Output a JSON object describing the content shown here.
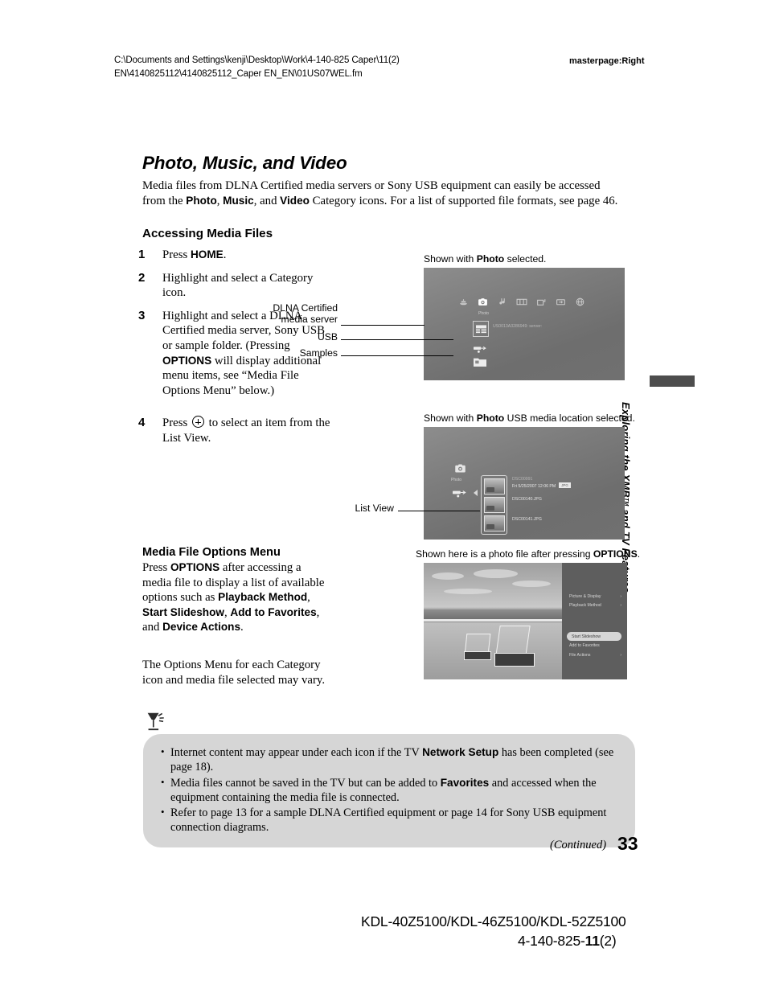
{
  "header": {
    "path_line1": "C:\\Documents and Settings\\kenji\\Desktop\\Work\\4-140-825 Caper\\11(2)",
    "path_line2": "EN\\4140825112\\4140825112_Caper EN_EN\\01US07WEL.fm",
    "masterpage": "masterpage:Right"
  },
  "title": "Photo, Music, and Video",
  "intro": {
    "part1": "Media files from DLNA Certified media servers or Sony USB equipment can easily be accessed from the ",
    "b1": "Photo",
    "sep1": ", ",
    "b2": "Music",
    "sep2": ", and ",
    "b3": "Video",
    "part2": " Category icons. For a list of supported file formats, see page 46."
  },
  "section_heading": "Accessing Media Files",
  "steps": [
    {
      "num": "1",
      "pre": "Press ",
      "bold": "HOME",
      "post": "."
    },
    {
      "num": "2",
      "pre": "Highlight and select a Category icon.",
      "bold": "",
      "post": ""
    },
    {
      "num": "3",
      "pre": "Highlight and select a DLNA Certified media server, Sony USB or sample folder. (Pressing ",
      "bold": "OPTIONS",
      "post": " will display additional menu items, see “Media File Options Menu” below.)"
    },
    {
      "num": "4",
      "pre": "Press ",
      "bold": "",
      "post": " to select an item from the List View."
    }
  ],
  "options_menu": {
    "heading": "Media File Options Menu",
    "p1_pre": "Press ",
    "p1_b1": "OPTIONS",
    "p1_mid": " after accessing a media file to display a list of available options such as ",
    "p1_b2": "Playback Method",
    "p1_sep1": ", ",
    "p1_b3": "Start Slideshow",
    "p1_sep2": ", ",
    "p1_b4": "Add to Favorites",
    "p1_sep3": ", and ",
    "p1_b5": "Device Actions",
    "p1_end": ".",
    "p2": "The Options Menu for each Category icon and media file selected may vary."
  },
  "captions": {
    "tv1_pre": "Shown with ",
    "tv1_b": "Photo",
    "tv1_post": " selected.",
    "tv2_pre": "Shown with ",
    "tv2_b": "Photo",
    "tv2_post": " USB media location selected.",
    "tv3_pre": "Shown here is a photo file after pressing ",
    "tv3_b": "OPTIONS",
    "tv3_post": "."
  },
  "callouts": {
    "dlna_line1": "DLNA Certified",
    "dlna_line2": "media server",
    "usb": "USB",
    "samples": "Samples",
    "list_view": "List View"
  },
  "tv1": {
    "icons": [
      "settings-icon",
      "photo-camera-icon",
      "music-note-icon",
      "video-film-icon",
      "game-controller-icon",
      "input-icon",
      "network-globe-icon"
    ],
    "selected_label": "Photo",
    "server_name": "US0013A3286949: server:"
  },
  "tv2": {
    "category_label": "Photo",
    "files": [
      {
        "name": "DSC00991",
        "meta": "Fri  5/25/2007   12:06 PM",
        "tag": "JPG",
        "selected": true
      },
      {
        "name": "DSC00140.JPG",
        "meta": "",
        "tag": "",
        "selected": false
      },
      {
        "name": "DSC00141.JPG",
        "meta": "",
        "tag": "",
        "selected": false
      }
    ]
  },
  "tv3": {
    "menu_items": [
      {
        "label": "Picture & Display",
        "arrow": "›",
        "highlighted": false
      },
      {
        "label": "Playback Method",
        "arrow": "›",
        "highlighted": false
      },
      {
        "label": "Start Slideshow",
        "arrow": "",
        "highlighted": true
      },
      {
        "label": "Add to Favorites",
        "arrow": "",
        "highlighted": false
      },
      {
        "label": "File Actions",
        "arrow": "›",
        "highlighted": false
      }
    ]
  },
  "side_tab": {
    "text_a": "Exploring the XMB",
    "text_tm": "TM",
    "text_b": " and TV Features"
  },
  "notes": [
    {
      "pre": "Internet content may appear under each icon if the TV ",
      "bold": "Network Setup",
      "post": " has been completed (see page 18)."
    },
    {
      "pre": "Media files cannot be saved in the TV but can be added to ",
      "bold": "Favorites",
      "post": " and accessed when the equipment containing the media file is connected."
    },
    {
      "pre": "Refer to page 13 for a sample DLNA Certified equipment or page 14 for Sony USB equipment connection diagrams.",
      "bold": "",
      "post": ""
    }
  ],
  "footer": {
    "continued": "(Continued)",
    "page_number": "33",
    "models": "KDL-40Z5100/KDL-46Z5100/KDL-52Z5100",
    "part_prefix": "4-140-825-",
    "part_bold": "11",
    "part_suffix": "(2)"
  },
  "colors": {
    "note_box_bg": "#d6d6d6",
    "tv_bg": "#7c7c7c",
    "tab_bar": "#4d4d4d",
    "menu_highlight": "#d6d6d6"
  }
}
